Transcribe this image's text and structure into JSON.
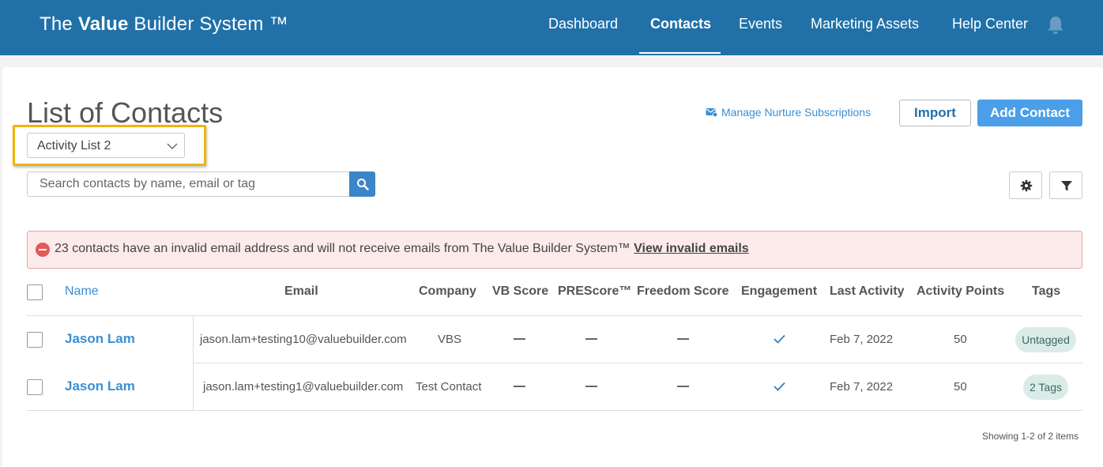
{
  "app": {
    "brand_prefix": "The ",
    "brand_bold": "Value",
    "brand_suffix": " Builder System ™"
  },
  "nav": {
    "items": [
      {
        "label": "Dashboard"
      },
      {
        "label": "Contacts",
        "active": true
      },
      {
        "label": "Events"
      },
      {
        "label": "Marketing Assets"
      },
      {
        "label": "Help Center"
      }
    ],
    "notification_icon": "bell-icon"
  },
  "page": {
    "title": "List of Contacts",
    "list_select": {
      "value": "Activity List 2"
    },
    "nurture_link": "Manage Nurture Subscriptions",
    "import_label": "Import",
    "add_contact_label": "Add Contact",
    "search": {
      "placeholder": "Search contacts by name, email or tag"
    },
    "settings_icon": "gear-icon",
    "filter_icon": "filter-icon"
  },
  "alert": {
    "message": "23 contacts have an invalid email address and will not receive emails from The Value Builder System™",
    "link": "View invalid emails"
  },
  "table": {
    "headers": {
      "name": "Name",
      "email": "Email",
      "company": "Company",
      "vb_score": "VB Score",
      "prescore": "PREScore™",
      "freedom_score": "Freedom Score",
      "engagement": "Engagement",
      "last_activity": "Last Activity",
      "activity_points": "Activity Points",
      "tags": "Tags"
    },
    "rows": [
      {
        "name": "Jason Lam",
        "email": "jason.lam+testing10@valuebuilder.com",
        "company": "VBS",
        "vb_score": "—",
        "prescore": "—",
        "freedom_score": "—",
        "engaged": true,
        "last_activity": "Feb 7, 2022",
        "activity_points": "50",
        "tag": "Untagged"
      },
      {
        "name": "Jason Lam",
        "email": "jason.lam+testing1@valuebuilder.com",
        "company": "Test Contact",
        "vb_score": "—",
        "prescore": "—",
        "freedom_score": "—",
        "engaged": true,
        "last_activity": "Feb 7, 2022",
        "activity_points": "50",
        "tag": "2 Tags"
      }
    ]
  },
  "pager": {
    "summary": "Showing 1-2 of 2 items"
  },
  "colors": {
    "header_bg": "#2171a8",
    "accent": "#3b8fd3",
    "primary_button": "#4a9fe8",
    "highlight_border": "#f0b400",
    "alert_bg": "#fcebea",
    "alert_icon": "#e45858",
    "tag_bg": "#dbece8"
  }
}
